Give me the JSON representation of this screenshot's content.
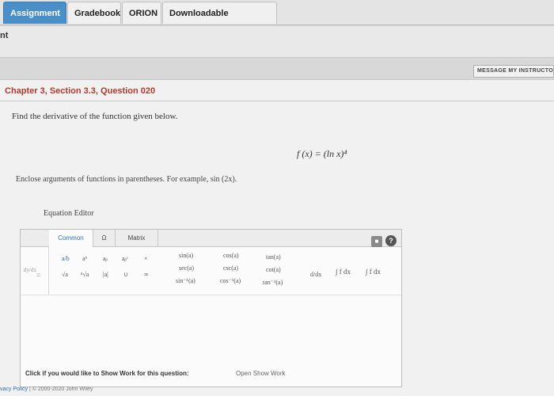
{
  "tabs": [
    {
      "label": "Assignment",
      "active": true
    },
    {
      "label": "Gradebook"
    },
    {
      "label": "ORION"
    },
    {
      "label": "Downloadable eTextbook"
    }
  ],
  "breadcrumb": "nt",
  "message_button": "MESSAGE MY INSTRUCTOR",
  "question": {
    "title": "Chapter 3, Section 3.3, Question 020",
    "prompt": "Find the derivative of the function given below.",
    "formula": "f (x) = (ln x)⁴",
    "hint": "Enclose arguments of functions in parentheses. For example, sin (2x)."
  },
  "editor": {
    "label": "Equation Editor",
    "tabs": [
      "Common",
      "Ω",
      "Matrix"
    ],
    "trash_icon": "trash-icon",
    "help_icon": "help-icon",
    "help_glyph": "?",
    "dy_dx": "dy/dx",
    "equals": "=",
    "symbols": {
      "frac": "a/b",
      "power": "aᵇ",
      "sub": "aᵦ",
      "subsup": "aᵦᶜ",
      "times": "×",
      "sqrt": "√a",
      "nthroot": "ⁿ√a",
      "abs": "|a|",
      "union": "∪",
      "infinity": "∞",
      "sin": "sin(a)",
      "sec": "sec(a)",
      "asin": "sin⁻¹(a)",
      "cos": "cos(a)",
      "csc": "csc(a)",
      "acos": "cos⁻¹(a)",
      "tan": "tan(a)",
      "cot": "cot(a)",
      "atan": "tan⁻¹(a)",
      "deriv": "d/dx",
      "integral": "∫ f dx",
      "def_integral": "∫ f dx"
    }
  },
  "bottom": {
    "note": "Click if you would like to Show Work for this question:",
    "show_work": "Open Show Work"
  },
  "footer": {
    "privacy": "vacy Policy",
    "separator": "|",
    "copyright": "© 2000-2020 John Wiley"
  }
}
